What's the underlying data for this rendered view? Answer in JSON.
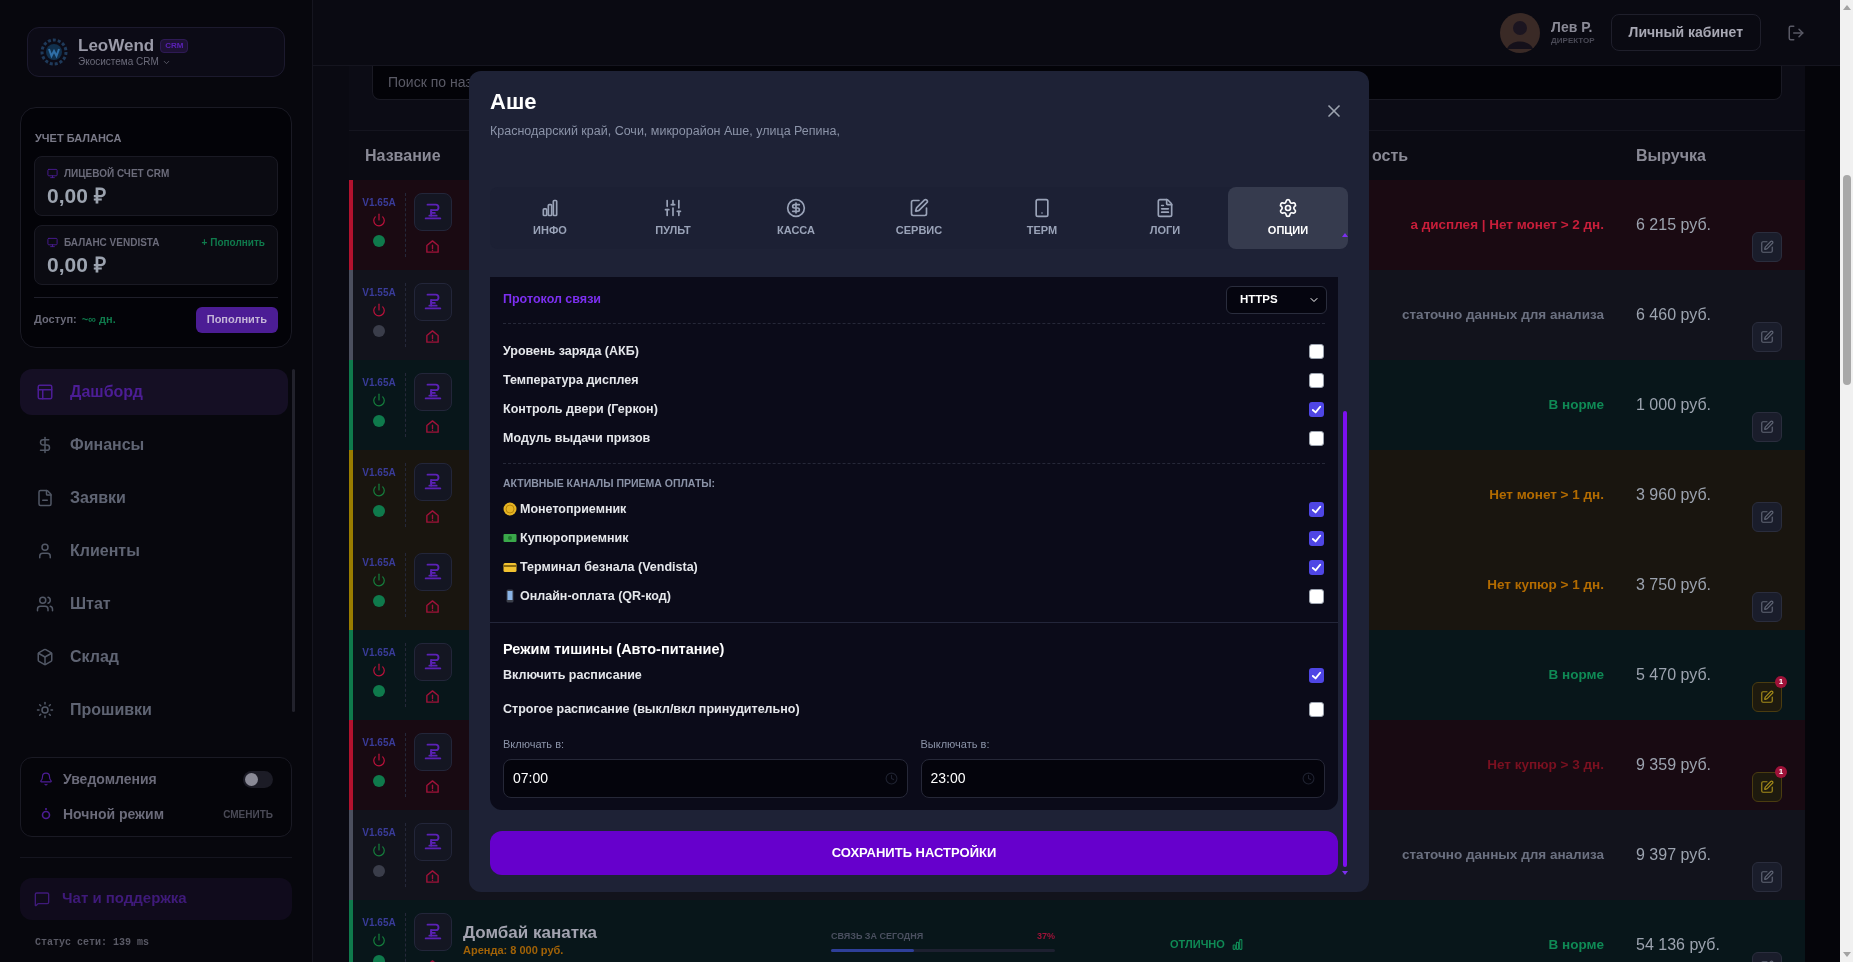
{
  "sidebar": {
    "logo": {
      "name": "LeoWend",
      "badge": "CRM",
      "subtitle": "Экосистема CRM"
    },
    "balance": {
      "title": "УЧЕТ БАЛАНСА",
      "accounts": [
        {
          "label": "ЛИЦЕВОЙ СЧЕТ CRM",
          "amount": "0,00 ₽"
        },
        {
          "label": "БАЛАНС VENDISTA",
          "amount": "0,00 ₽",
          "action": "+ Пополнить"
        }
      ],
      "access_label": "Доступ:",
      "access_value": "~∞ дн.",
      "topup_button": "Пополнить"
    },
    "nav": [
      {
        "label": "Дашборд",
        "selected": true
      },
      {
        "label": "Финансы",
        "selected": false
      },
      {
        "label": "Заявки",
        "selected": false
      },
      {
        "label": "Клиенты",
        "selected": false
      },
      {
        "label": "Штат",
        "selected": false
      },
      {
        "label": "Склад",
        "selected": false
      },
      {
        "label": "Прошивки",
        "selected": false
      }
    ],
    "settings": {
      "notifications": {
        "label": "Уведомления",
        "on": false
      },
      "night_mode": {
        "label": "Ночной режим",
        "action": "СМЕНИТЬ"
      }
    },
    "chat": "Чат и поддержка",
    "network_status": "Статус сети: 139 ms"
  },
  "header": {
    "user_name": "Лев Р.",
    "user_role": "ДИРЕКТОР",
    "cabinet_button": "Личный кабинет"
  },
  "search": {
    "placeholder": "Поиск по наз"
  },
  "table": {
    "columns": [
      "Название",
      "ость",
      "Выручка"
    ],
    "rows": [
      {
        "kind": "error",
        "version": "V1.65A",
        "power_on": false,
        "online": true,
        "status": "а дисплея | Нет монет > 2 дн.",
        "revenue": "6 215 руб."
      },
      {
        "kind": "nodata",
        "version": "V1.55A",
        "power_on": false,
        "online": false,
        "status": "статочно данных для анализа",
        "revenue": "6 460 руб."
      },
      {
        "kind": "ok",
        "version": "V1.65A",
        "power_on": true,
        "online": true,
        "status": "В норме",
        "revenue": "1 000 руб."
      },
      {
        "kind": "warn",
        "version": "V1.65A",
        "power_on": true,
        "online": true,
        "status": "Нет монет > 1 дн.",
        "revenue": "3 960 руб."
      },
      {
        "kind": "warn",
        "version": "V1.65A",
        "power_on": true,
        "online": true,
        "status": "Нет купюр > 1 дн.",
        "revenue": "3 750 руб."
      },
      {
        "kind": "ok",
        "version": "V1.65A",
        "power_on": false,
        "online": true,
        "status": "В норме",
        "revenue": "5 470 руб.",
        "badge": "1"
      },
      {
        "kind": "alarm",
        "version": "V1.65A",
        "power_on": false,
        "online": true,
        "status": "Нет купюр > 3 дн.",
        "revenue": "9 359 руб.",
        "badge": "1"
      },
      {
        "kind": "nodata",
        "version": "V1.65A",
        "power_on": true,
        "online": false,
        "status": "статочно данных для анализа",
        "revenue": "9 397 руб."
      },
      {
        "kind": "ok",
        "version": "V1.65A",
        "power_on": true,
        "online": true,
        "name": "Домбай канатка",
        "rent": "Аренда: 8 000 руб.",
        "link_label": "СВЯЗЬ ЗА СЕГОДНЯ",
        "link_value": "37%",
        "level": 0.37,
        "quality": "ОТЛИЧНО",
        "status": "В норме",
        "revenue": "54 136 руб."
      }
    ]
  },
  "modal": {
    "title": "Аше",
    "address": "Краснодарский край, Сочи, микрорайон Аше, улица Репина,",
    "tabs": [
      {
        "label": "ИНФО",
        "selected": false
      },
      {
        "label": "ПУЛЬТ",
        "selected": false
      },
      {
        "label": "КАССА",
        "selected": false
      },
      {
        "label": "СЕРВИС",
        "selected": false
      },
      {
        "label": "ТЕРМ",
        "selected": false
      },
      {
        "label": "ЛОГИ",
        "selected": false
      },
      {
        "label": "ОПЦИИ",
        "selected": true
      }
    ],
    "protocol": {
      "label": "Протокол связи",
      "value": "HTTPS"
    },
    "sensors": [
      {
        "label": "Уровень заряда (АКБ)",
        "checked": false
      },
      {
        "label": "Температура дисплея",
        "checked": false
      },
      {
        "label": "Контроль двери (Геркон)",
        "checked": true
      },
      {
        "label": "Модуль выдачи призов",
        "checked": false
      }
    ],
    "payment_title": "АКТИВНЫЕ КАНАЛЫ ПРИЕМА ОПЛАТЫ:",
    "payment_channels": [
      {
        "label": "Монетоприемник",
        "checked": true
      },
      {
        "label": "Купюроприемник",
        "checked": true
      },
      {
        "label": "Терминал безнала (Vendista)",
        "checked": true
      },
      {
        "label": "Онлайн-оплата (QR-код)",
        "checked": false
      }
    ],
    "silence": {
      "title": "Режим тишины (Авто-питание)",
      "options": [
        {
          "label": "Включить расписание",
          "checked": true
        },
        {
          "label": "Строгое расписание (выкл/вкл принудительно)",
          "checked": false
        }
      ],
      "on_label": "Включать в:",
      "on_time": "07:00",
      "off_label": "Выключать в:",
      "off_time": "23:00"
    },
    "save_button": "СОХРАНИТЬ НАСТРОЙКИ"
  }
}
